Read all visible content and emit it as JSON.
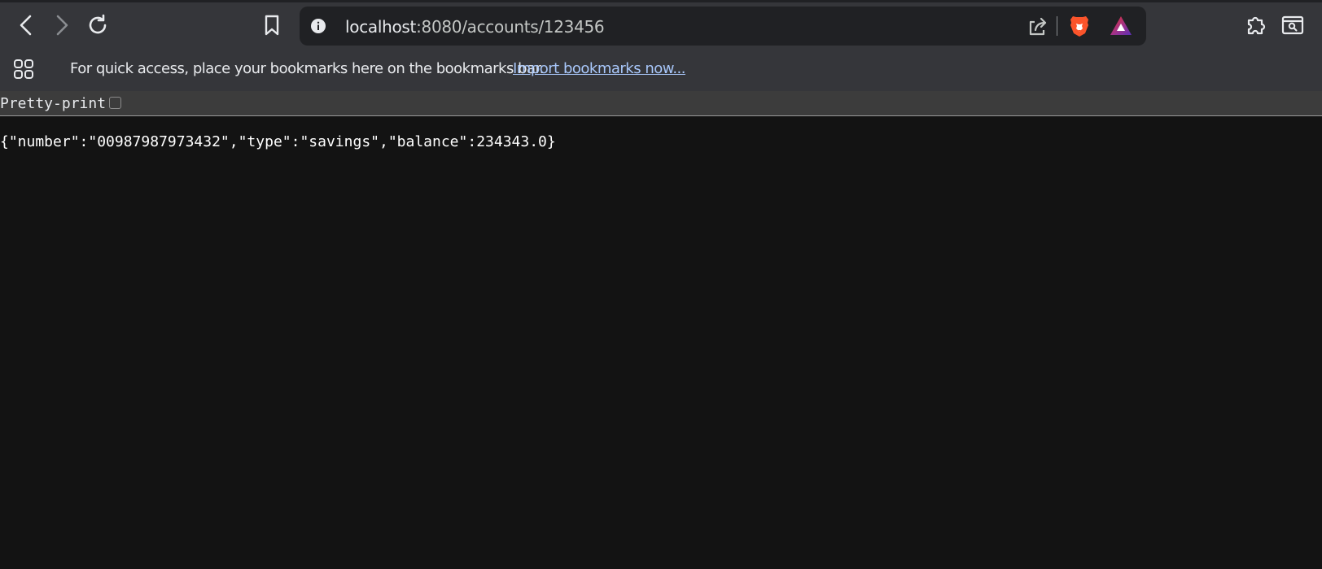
{
  "browser": {
    "url": {
      "host": "localhost",
      "path": ":8080/accounts/123456"
    },
    "icons": {
      "back": "chevron-left-icon",
      "forward": "chevron-right-icon",
      "reload": "reload-icon",
      "bookmark": "bookmark-icon",
      "site_info": "info-icon",
      "share": "share-icon",
      "brave_shields": "brave-lion-icon",
      "brave_rewards": "triangle-icon",
      "extensions": "puzzle-icon",
      "reading_list": "window-search-icon",
      "apps": "apps-grid-icon"
    }
  },
  "bookmarks_bar": {
    "message": "For quick access, place your bookmarks here on the bookmarks bar.",
    "import_link": "Import bookmarks now..."
  },
  "viewer": {
    "pretty_print_label": "Pretty-print",
    "pretty_print_checked": false,
    "json_text": "{\"number\":\"00987987973432\",\"type\":\"savings\",\"balance\":234343.0}"
  },
  "colors": {
    "toolbar_bg": "#35363a",
    "omnibox_bg": "#202124",
    "page_bg": "#131313",
    "link": "#a8c7fa",
    "brave_orange": "#fb542b"
  }
}
